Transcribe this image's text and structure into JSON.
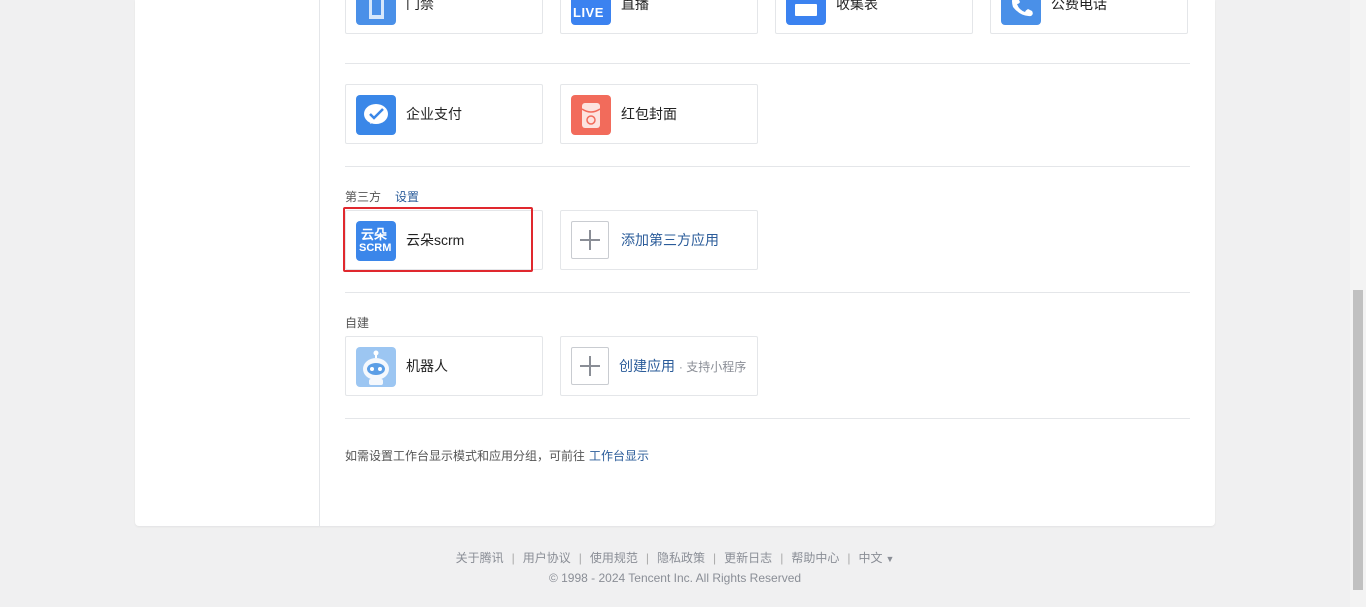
{
  "top_row": [
    {
      "label": "门禁",
      "icon": "door-icon"
    },
    {
      "label": "直播",
      "icon": "live-icon",
      "icon_text": "LIVE"
    },
    {
      "label": "收集表",
      "icon": "form-icon"
    },
    {
      "label": "公费电话",
      "icon": "phone-icon"
    }
  ],
  "apps": {
    "pay": {
      "label": "企业支付",
      "icon": "wechat-pay-icon"
    },
    "red_packet": {
      "label": "红包封面",
      "icon": "red-packet-icon"
    }
  },
  "third_party": {
    "title": "第三方",
    "settings": "设置",
    "yunduo": {
      "label": "云朵scrm",
      "icon_line1": "云朵",
      "icon_line2": "SCRM"
    },
    "add": "添加第三方应用"
  },
  "custom": {
    "title": "自建",
    "robot": "机器人",
    "create": "创建应用",
    "create_sub": "· 支持小程序"
  },
  "hint": {
    "text": "如需设置工作台显示模式和应用分组，可前往",
    "link": "工作台显示"
  },
  "footer": {
    "links": [
      "关于腾讯",
      "用户协议",
      "使用规范",
      "隐私政策",
      "更新日志",
      "帮助中心"
    ],
    "lang": "中文",
    "copyright": "© 1998 - 2024 Tencent Inc. All Rights Reserved"
  },
  "colors": {
    "accent": "#2b5c9a",
    "highlight": "#e0282e",
    "icon_blue": "#3b82f0",
    "icon_red": "#f26b5b"
  }
}
